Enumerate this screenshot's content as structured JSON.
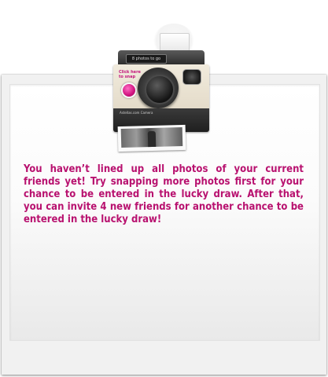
{
  "camera": {
    "lcd_text": "8 photos to go",
    "click_label_line1": "Click here",
    "click_label_line2": "to snap",
    "brand_text": "Astellas.com Camera",
    "shutter_color": "#d0137f"
  },
  "message": {
    "text": "You haven’t lined up all photos of your current friends yet! Try snapping more photos first for your chance to be entered in the lucky draw. After that, you can invite 4 new friends for another chance to be entered in the lucky draw!",
    "color": "#b8116f"
  }
}
